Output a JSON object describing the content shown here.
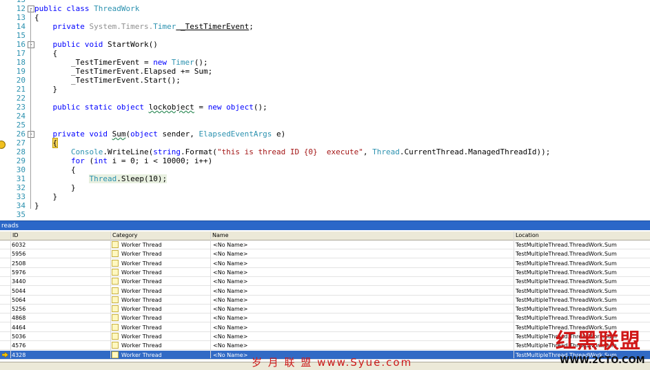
{
  "editor": {
    "lines": [
      {
        "n": "13",
        "html": ""
      },
      {
        "n": "12",
        "fold": "-",
        "segs": [
          [
            "kw",
            "public class "
          ],
          [
            "ty",
            "ThreadWork"
          ]
        ]
      },
      {
        "n": "13",
        "segs": [
          [
            "",
            "{"
          ]
        ]
      },
      {
        "n": "14",
        "segs": [
          [
            "kw",
            "    private "
          ],
          [
            "dim",
            "System.Timers."
          ],
          [
            "ty",
            "Timer"
          ],
          [
            "",
            ""
          ],
          [
            "ul",
            " _TestTimerEvent"
          ],
          [
            "",
            ";"
          ]
        ]
      },
      {
        "n": "15",
        "segs": []
      },
      {
        "n": "16",
        "fold": "-",
        "segs": [
          [
            "kw",
            "    public void "
          ],
          [
            "",
            "StartWork()"
          ]
        ]
      },
      {
        "n": "17",
        "segs": [
          [
            "",
            "    {"
          ]
        ]
      },
      {
        "n": "18",
        "segs": [
          [
            "",
            "        _TestTimerEvent = "
          ],
          [
            "kw",
            "new "
          ],
          [
            "ty",
            "Timer"
          ],
          [
            "",
            "();"
          ]
        ]
      },
      {
        "n": "19",
        "segs": [
          [
            "",
            "        _TestTimerEvent.Elapsed += Sum;"
          ]
        ]
      },
      {
        "n": "20",
        "segs": [
          [
            "",
            "        _TestTimerEvent.Start();"
          ]
        ]
      },
      {
        "n": "21",
        "segs": [
          [
            "",
            "    }"
          ]
        ]
      },
      {
        "n": "22",
        "segs": []
      },
      {
        "n": "23",
        "segs": [
          [
            "kw",
            "    public static object "
          ],
          [
            "sq",
            "lockobject"
          ],
          [
            "",
            ""
          ],
          [
            "",
            ""
          ],
          [
            "",
            " = "
          ],
          [
            "kw",
            "new object"
          ],
          [
            "",
            "();"
          ]
        ]
      },
      {
        "n": "24",
        "segs": []
      },
      {
        "n": "25",
        "segs": []
      },
      {
        "n": "26",
        "fold": "-",
        "segs": [
          [
            "kw",
            "    private void "
          ],
          [
            "sq",
            "Sum"
          ],
          [
            "",
            "("
          ],
          [
            "kw",
            "object"
          ],
          [
            "",
            " sender, "
          ],
          [
            "ty",
            "ElapsedEventArgs"
          ],
          [
            "",
            " e)"
          ]
        ]
      },
      {
        "n": "27",
        "segs": [
          [
            "",
            "    "
          ],
          [
            "hl",
            "{"
          ]
        ]
      },
      {
        "n": "28",
        "segs": [
          [
            "",
            "        "
          ],
          [
            "ty",
            "Console"
          ],
          [
            "",
            ".WriteLine("
          ],
          [
            "kw",
            "string"
          ],
          [
            "",
            ".Format("
          ],
          [
            "st",
            "\"this is thread ID {0}  execute\""
          ],
          [
            "",
            ", "
          ],
          [
            "ty",
            "Thread"
          ],
          [
            "",
            ".CurrentThread.ManagedThreadId));"
          ]
        ]
      },
      {
        "n": "29",
        "segs": [
          [
            "kw",
            "        for "
          ],
          [
            "",
            "("
          ],
          [
            "kw",
            "int"
          ],
          [
            "",
            " i = 0; i < 10000; i++)"
          ]
        ]
      },
      {
        "n": "30",
        "segs": [
          [
            "",
            "        {"
          ]
        ]
      },
      {
        "n": "31",
        "segs": [
          [
            "",
            "            "
          ],
          [
            "tyhl",
            "Thread"
          ],
          [
            "cur",
            ".Sleep(10);"
          ]
        ]
      },
      {
        "n": "32",
        "segs": [
          [
            "",
            "        }"
          ]
        ]
      },
      {
        "n": "33",
        "segs": [
          [
            "",
            "    }"
          ]
        ]
      },
      {
        "n": "34",
        "segs": [
          [
            "",
            "}"
          ]
        ]
      },
      {
        "n": "35",
        "segs": []
      }
    ]
  },
  "threads": {
    "title": "reads",
    "columns": [
      "ID",
      "Category",
      "Name",
      "Location"
    ],
    "rows": [
      {
        "id": "6032",
        "category": "Worker Thread",
        "name": "<No Name>",
        "location": "TestMultipleThread.ThreadWork.Sum"
      },
      {
        "id": "5956",
        "category": "Worker Thread",
        "name": "<No Name>",
        "location": "TestMultipleThread.ThreadWork.Sum"
      },
      {
        "id": "2508",
        "category": "Worker Thread",
        "name": "<No Name>",
        "location": "TestMultipleThread.ThreadWork.Sum"
      },
      {
        "id": "5976",
        "category": "Worker Thread",
        "name": "<No Name>",
        "location": "TestMultipleThread.ThreadWork.Sum"
      },
      {
        "id": "3440",
        "category": "Worker Thread",
        "name": "<No Name>",
        "location": "TestMultipleThread.ThreadWork.Sum"
      },
      {
        "id": "5044",
        "category": "Worker Thread",
        "name": "<No Name>",
        "location": "TestMultipleThread.ThreadWork.Sum"
      },
      {
        "id": "5064",
        "category": "Worker Thread",
        "name": "<No Name>",
        "location": "TestMultipleThread.ThreadWork.Sum"
      },
      {
        "id": "5256",
        "category": "Worker Thread",
        "name": "<No Name>",
        "location": "TestMultipleThread.ThreadWork.Sum"
      },
      {
        "id": "4868",
        "category": "Worker Thread",
        "name": "<No Name>",
        "location": "TestMultipleThread.ThreadWork.Sum"
      },
      {
        "id": "4464",
        "category": "Worker Thread",
        "name": "<No Name>",
        "location": "TestMultipleThread.ThreadWork.Sum"
      },
      {
        "id": "5036",
        "category": "Worker Thread",
        "name": "<No Name>",
        "location": "TestMultipleThread.ThreadWork.Sum"
      },
      {
        "id": "4576",
        "category": "Worker Thread",
        "name": "<No Name>",
        "location": "TestMultipleThread.ThreadWork.Sum"
      },
      {
        "id": "4328",
        "category": "Worker Thread",
        "name": "<No Name>",
        "location": "TestMultipleThread.ThreadWork.Sum",
        "selected": true
      }
    ]
  },
  "watermarks": {
    "site_cn": "岁 月 联 盟   www.Syue.com",
    "logo": "红黑联盟",
    "url": "WWW.2CTO.COM"
  },
  "colors": {
    "keyword": "#0000ff",
    "type": "#2b91af",
    "string": "#a31515",
    "selection": "#316ac5",
    "tool_title": "#2b67c8"
  }
}
